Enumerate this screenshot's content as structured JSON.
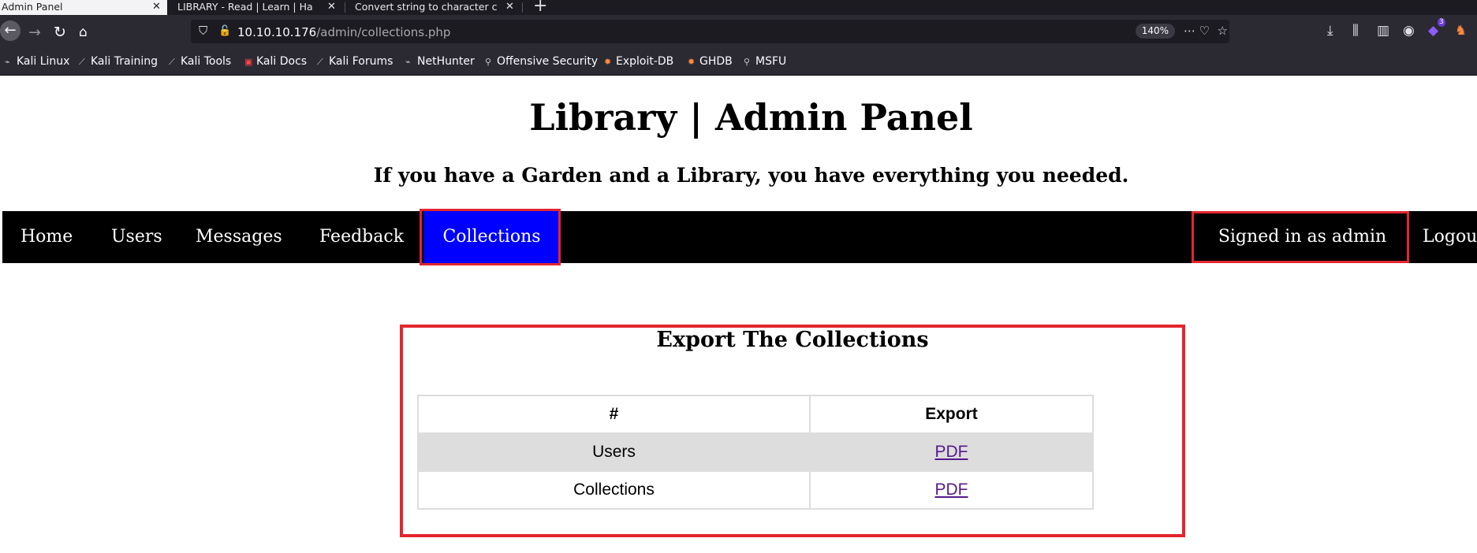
{
  "browser": {
    "tabs": [
      {
        "title": "Admin Panel",
        "active": true
      },
      {
        "title": "LIBRARY - Read | Learn | Ha",
        "active": false
      },
      {
        "title": "Convert string to character c",
        "active": false
      }
    ],
    "url_host": "10.10.10.176",
    "url_path": "/admin/collections.php",
    "zoom": "140%",
    "bookmarks": [
      "Kali Linux",
      "Kali Training",
      "Kali Tools",
      "Kali Docs",
      "Kali Forums",
      "NetHunter",
      "Offensive Security",
      "Exploit-DB",
      "GHDB",
      "MSFU"
    ],
    "extension_badge": "3"
  },
  "page": {
    "title": "Library | Admin Panel",
    "tagline": "If you have a Garden and a Library, you have everything you needed.",
    "nav": {
      "items": [
        "Home",
        "Users",
        "Messages",
        "Feedback",
        "Collections"
      ],
      "active": "Collections",
      "signed_in": "Signed in as admin",
      "logout": "Logout"
    },
    "export": {
      "heading": "Export The Collections",
      "columns": [
        "#",
        "Export"
      ],
      "rows": [
        {
          "name": "Users",
          "link": "PDF"
        },
        {
          "name": "Collections",
          "link": "PDF"
        }
      ]
    }
  },
  "colors": {
    "highlight": "#e3262f",
    "active_nav": "#0000ff",
    "nav_bg": "#000000",
    "link": "#551a8b"
  }
}
